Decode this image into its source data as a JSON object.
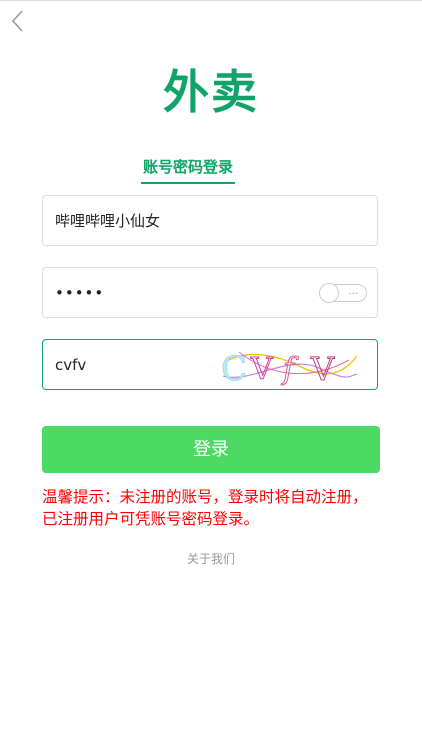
{
  "header": {
    "back_icon": "chevron-left-icon"
  },
  "logo": {
    "text": "外卖",
    "color": "#10a36a"
  },
  "tab": {
    "label": "账号密码登录"
  },
  "form": {
    "username_value": "哔哩哔哩小仙女",
    "password_value": "•••••",
    "password_toggle_icon": "toggle-switch-icon",
    "password_toggle_dots": "...",
    "captcha_value": "cvfv",
    "captcha_image_text": "CVfV"
  },
  "login_button": {
    "label": "登录",
    "color": "#4cd964"
  },
  "notice": {
    "text": "温馨提示：未注册的账号，登录时将自动注册，已注册用户可凭账号密码登录。",
    "color": "#ff0000"
  },
  "footer": {
    "about_link": "关于我们"
  }
}
